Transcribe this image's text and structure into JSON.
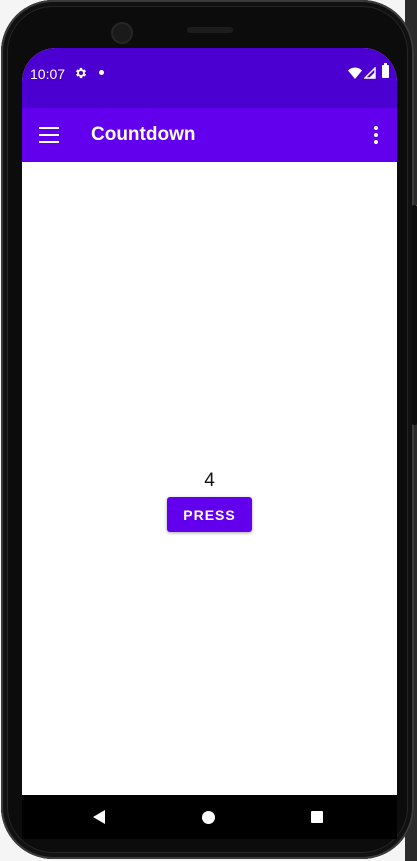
{
  "status_bar": {
    "time": "10:07",
    "icons": [
      "gear-icon",
      "dot-icon",
      "wifi-icon",
      "signal-icon",
      "battery-icon"
    ]
  },
  "app_bar": {
    "title": "Countdown",
    "left_icon": "menu-icon",
    "right_icon": "overflow-icon"
  },
  "main": {
    "count": "4",
    "button_label": "PRESS"
  },
  "nav_bar": {
    "icons": [
      "back-icon",
      "home-icon",
      "recents-icon"
    ]
  },
  "colors": {
    "status_bar": "#4b00d1",
    "app_bar": "#6200ee",
    "button": "#6200ee",
    "nav_bar": "#000000"
  }
}
